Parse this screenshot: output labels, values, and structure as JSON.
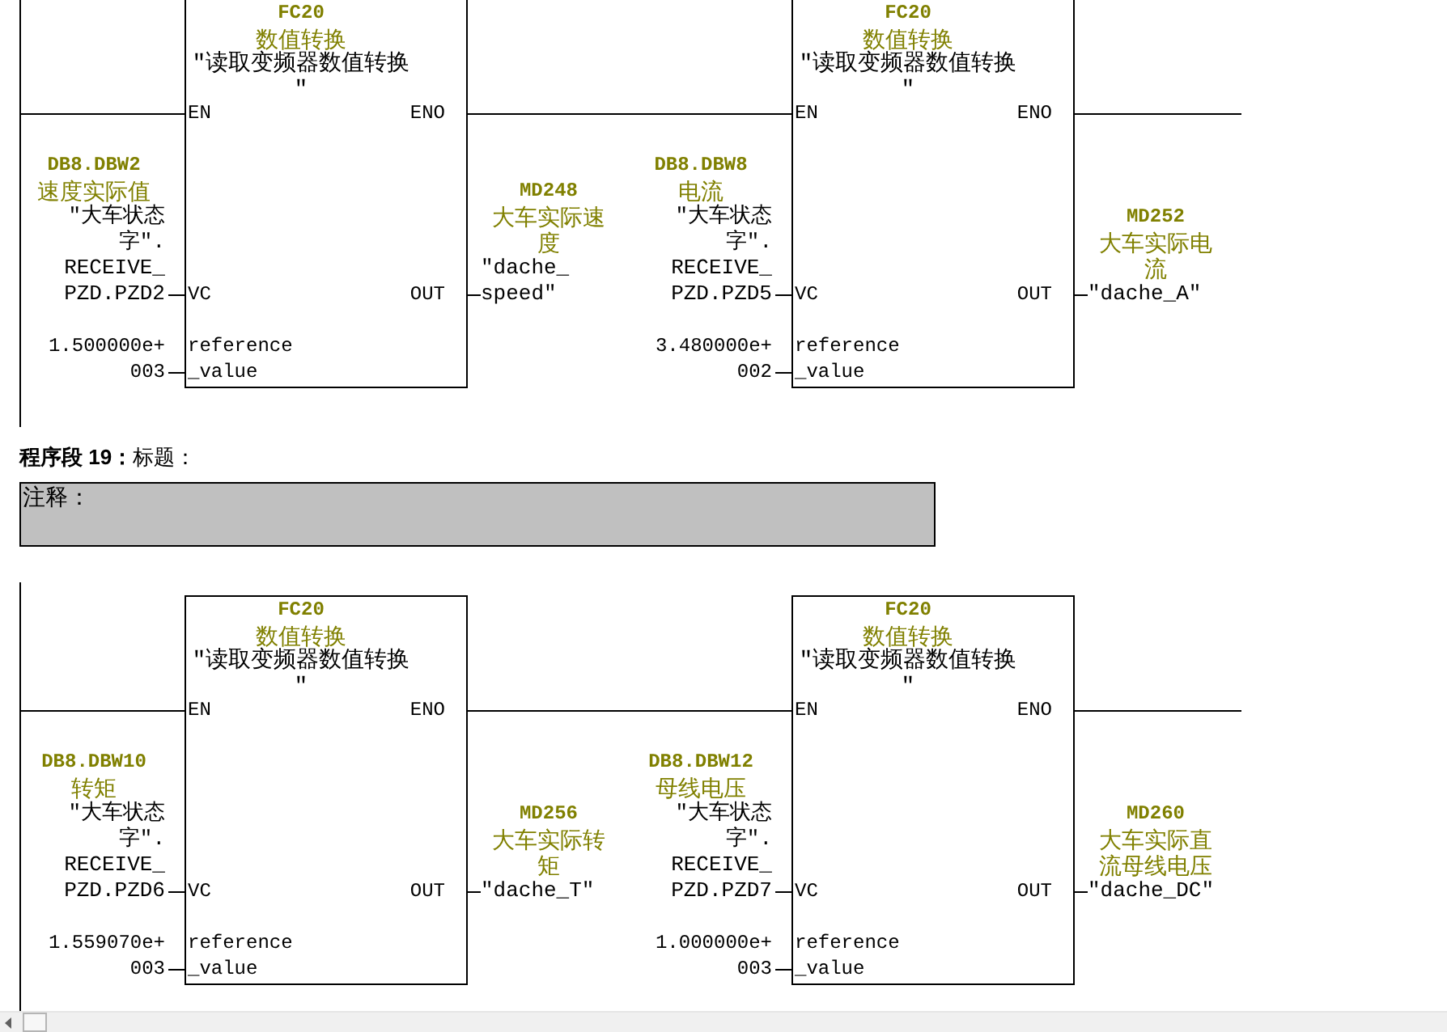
{
  "networks": [
    {
      "blocks": [
        {
          "number": "FC20",
          "comment": "数值转换",
          "symbol": [
            "\"读取变频器数值转换",
            "\""
          ],
          "en": "EN",
          "eno": "ENO",
          "inputs": [
            {
              "kind": "operand",
              "pin": [
                "VC"
              ],
              "address": "DB8.DBW2",
              "comment": "速度实际值",
              "symbol": [
                "\"大车状态",
                "字\".",
                "RECEIVE_",
                "PZD.PZD2"
              ]
            },
            {
              "kind": "constant",
              "pin": [
                "reference",
                "_value"
              ],
              "value": [
                "1.500000e+",
                "003"
              ]
            }
          ],
          "outputs": [
            {
              "kind": "operand",
              "pin": [
                "OUT"
              ],
              "address": "MD248",
              "comment": "大车实际速度",
              "symbol": [
                "\"dache_",
                "speed\""
              ]
            }
          ]
        },
        {
          "number": "FC20",
          "comment": "数值转换",
          "symbol": [
            "\"读取变频器数值转换",
            "\""
          ],
          "en": "EN",
          "eno": "ENO",
          "inputs": [
            {
              "kind": "operand",
              "pin": [
                "VC"
              ],
              "address": "DB8.DBW8",
              "comment": "电流",
              "symbol": [
                "\"大车状态",
                "字\".",
                "RECEIVE_",
                "PZD.PZD5"
              ]
            },
            {
              "kind": "constant",
              "pin": [
                "reference",
                "_value"
              ],
              "value": [
                "3.480000e+",
                "002"
              ]
            }
          ],
          "outputs": [
            {
              "kind": "operand",
              "pin": [
                "OUT"
              ],
              "address": "MD252",
              "comment": "大车实际电流",
              "symbol": [
                "\"dache_A\""
              ]
            }
          ]
        }
      ]
    },
    {
      "title": "**程序段 19：**标题：",
      "comment": "注释：",
      "blocks": [
        {
          "number": "FC20",
          "comment": "数值转换",
          "symbol": [
            "\"读取变频器数值转换",
            "\""
          ],
          "en": "EN",
          "eno": "ENO",
          "inputs": [
            {
              "kind": "operand",
              "pin": [
                "VC"
              ],
              "address": "DB8.DBW10",
              "comment": "转矩",
              "symbol": [
                "\"大车状态",
                "字\".",
                "RECEIVE_",
                "PZD.PZD6"
              ]
            },
            {
              "kind": "constant",
              "pin": [
                "reference",
                "_value"
              ],
              "value": [
                "1.559070e+",
                "003"
              ]
            }
          ],
          "outputs": [
            {
              "kind": "operand",
              "pin": [
                "OUT"
              ],
              "address": "MD256",
              "comment": "大车实际转矩",
              "symbol": [
                "\"dache_T\""
              ]
            }
          ]
        },
        {
          "number": "FC20",
          "comment": "数值转换",
          "symbol": [
            "\"读取变频器数值转换",
            "\""
          ],
          "en": "EN",
          "eno": "ENO",
          "inputs": [
            {
              "kind": "operand",
              "pin": [
                "VC"
              ],
              "address": "DB8.DBW12",
              "comment": "母线电压",
              "symbol": [
                "\"大车状态",
                "字\".",
                "RECEIVE_",
                "PZD.PZD7"
              ]
            },
            {
              "kind": "constant",
              "pin": [
                "reference",
                "_value"
              ],
              "value": [
                "1.000000e+",
                "003"
              ]
            }
          ],
          "outputs": [
            {
              "kind": "operand",
              "pin": [
                "OUT"
              ],
              "address": "MD260",
              "comment": "大车实际直流母线电压",
              "symbol": [
                "\"dache_DC\""
              ]
            }
          ]
        }
      ]
    }
  ]
}
